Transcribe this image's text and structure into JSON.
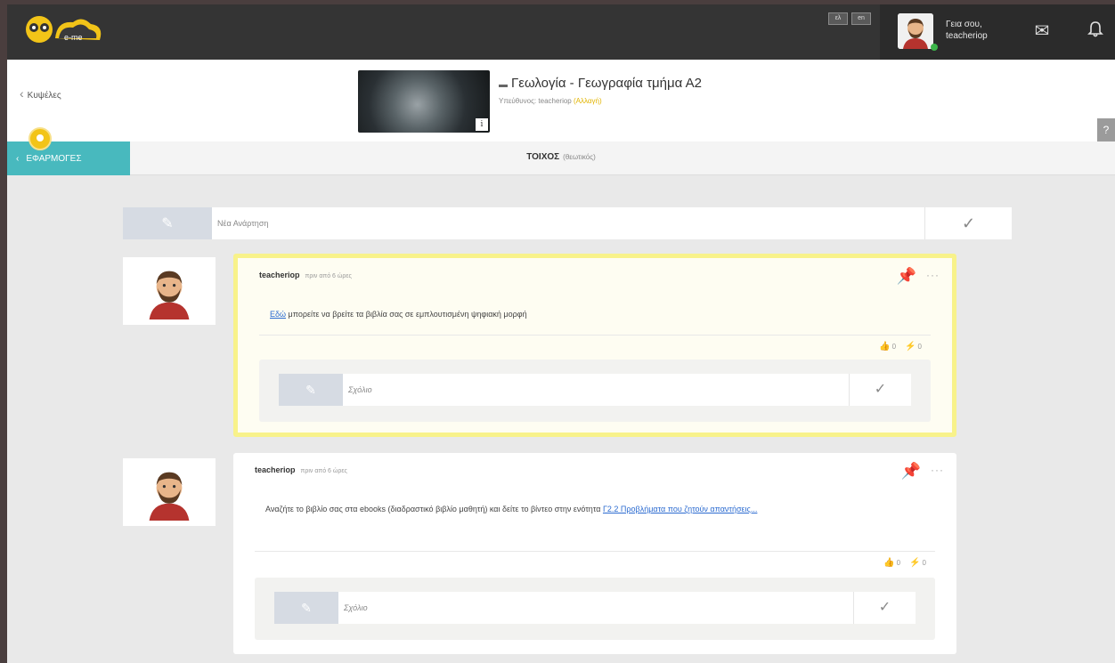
{
  "topbar": {
    "logo_text": "e-me",
    "lang_1": "ελ",
    "lang_2": "en",
    "greeting_line1": "Γεια σου,",
    "greeting_line2": "teacheriop",
    "mail_icon": "mail-icon",
    "bell_icon": "bell-icon"
  },
  "header": {
    "back_label": "Κυψέλες",
    "course_title": "Γεωλογία - Γεωγραφία τμήμα Α2",
    "owner_prefix": "Υπεύθυνος:",
    "owner_name": "teacheriop",
    "change_label": "(Αλλαγή)",
    "info_label": "i"
  },
  "apps": {
    "label": "ΕΦΑΡΜΟΓΕΣ",
    "wall_title": "ΤΟΙΧΟΣ",
    "wall_subtitle": "(θεωτικός)"
  },
  "compose": {
    "placeholder": "Νέα Ανάρτηση"
  },
  "posts": [
    {
      "author": "teacheriop",
      "time": "πριν από 6 ώρες",
      "link_text": "Εδώ",
      "text": " μπορείτε να βρείτε τα βιβλία σας σε εμπλουτισμένη ψηφιακή μορφή",
      "likes": "0",
      "shares": "0",
      "comment_placeholder": "Σχόλιο",
      "pinned": true
    },
    {
      "author": "teacheriop",
      "time": "πριν από 6 ώρες",
      "text": "Αναζήτε το βιβλίο σας στα ebooks (διαδραστικό βιβλίο μαθητή) και δείτε το βίντεο στην ενότητα ",
      "link_text": "Γ2.2 Προβλήματα που ζητούν απαντήσεις...",
      "likes": "0",
      "shares": "0",
      "comment_placeholder": "Σχόλιο",
      "pinned": false
    }
  ],
  "colors": {
    "topbar": "#343434",
    "accent_teal": "#48b9be",
    "pin_yellow": "#f8f28a",
    "link_blue": "#2a6ad0"
  }
}
